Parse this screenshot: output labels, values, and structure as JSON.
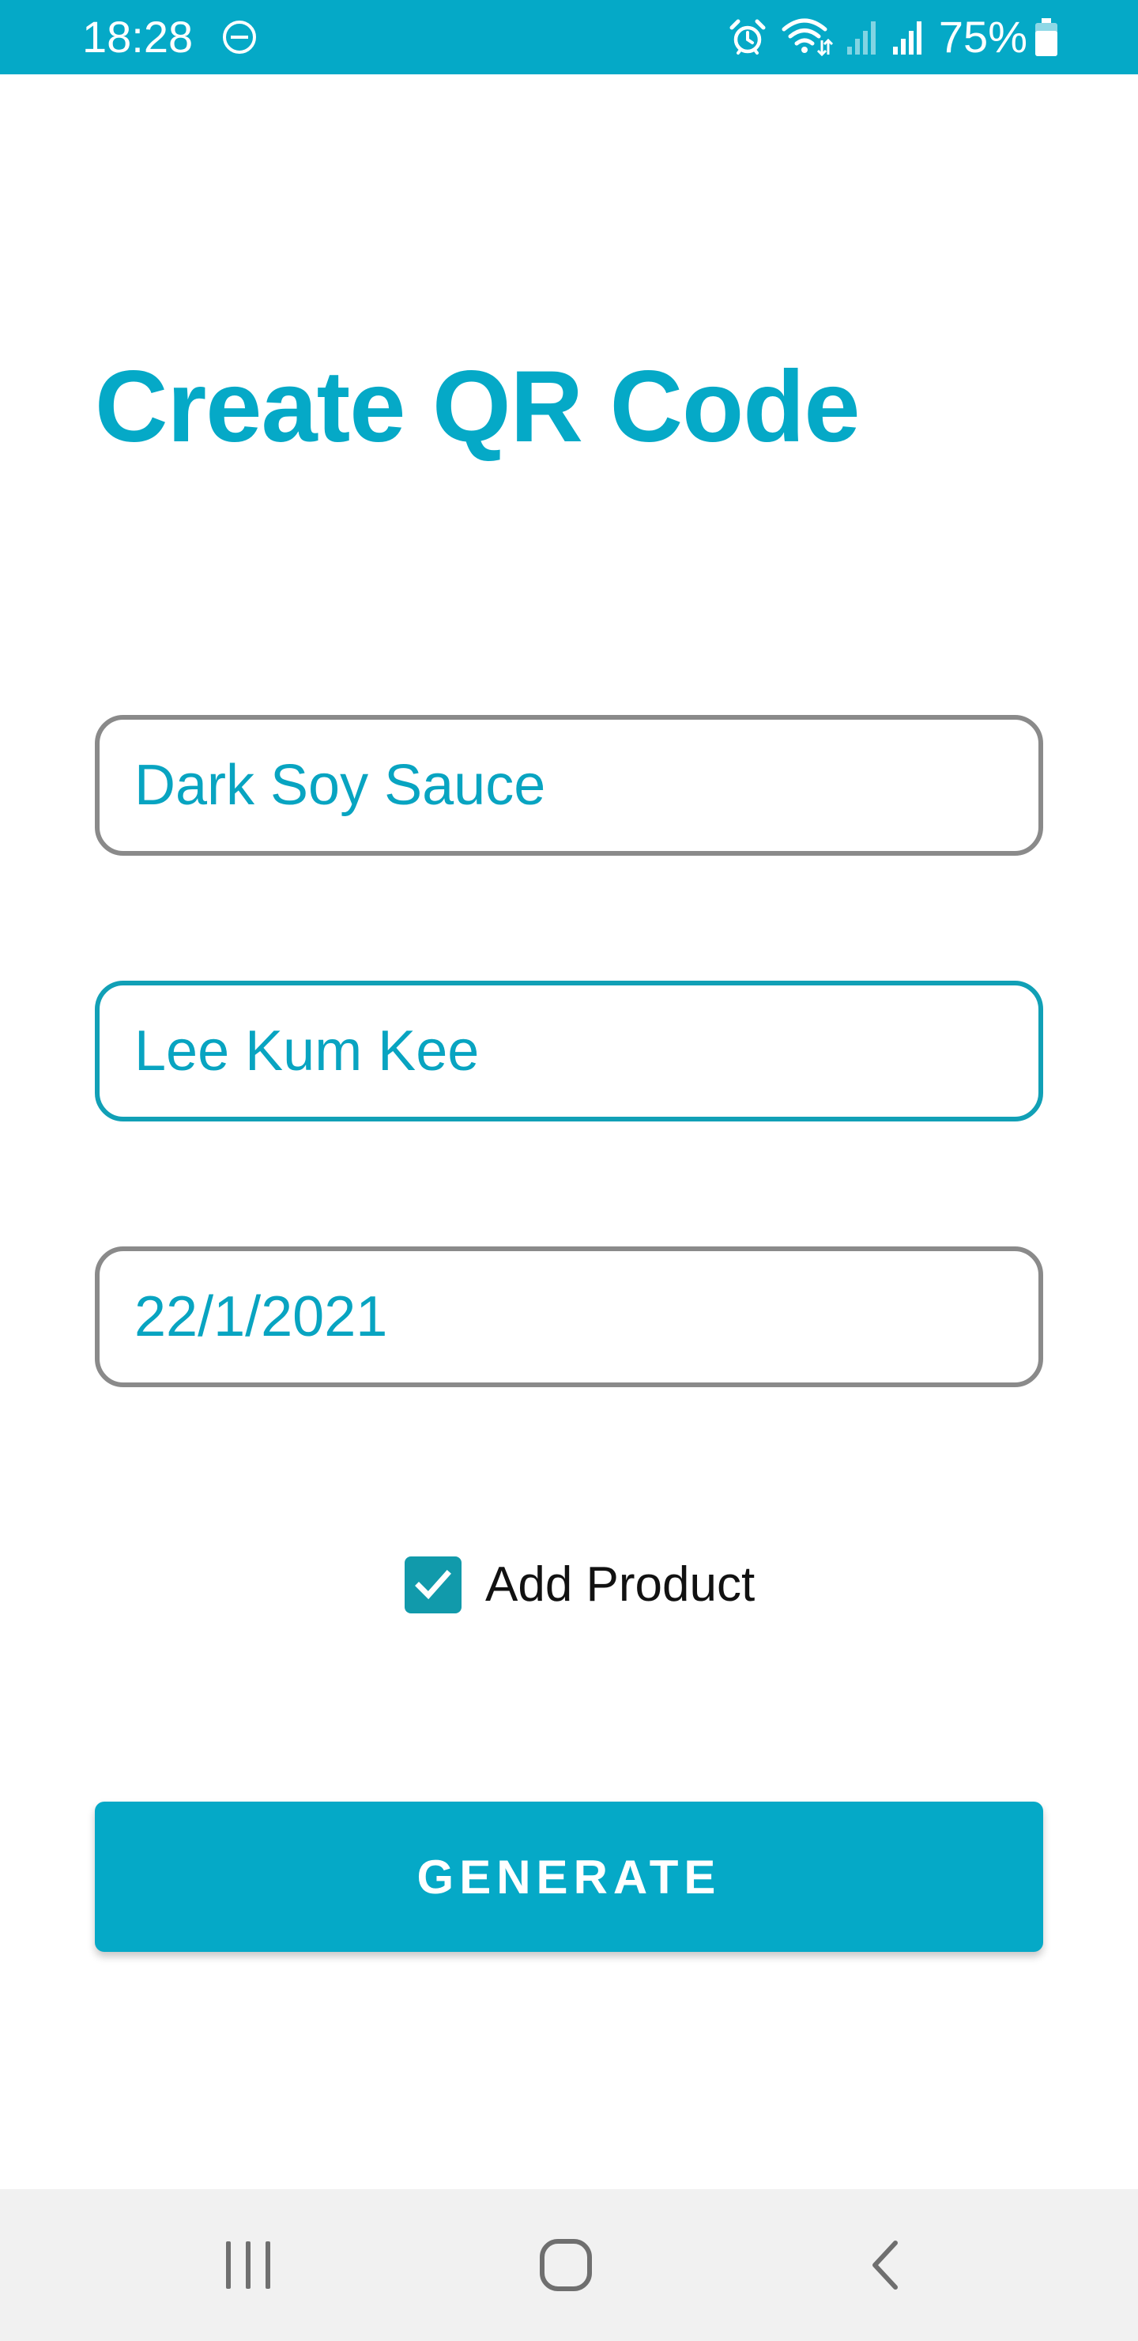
{
  "status_bar": {
    "time": "18:28",
    "battery": "75%",
    "background_color": "#05a9c7",
    "icons": [
      "do-not-disturb-icon",
      "alarm-icon",
      "wifi-icon",
      "signal-icon",
      "signal-icon",
      "battery-icon"
    ]
  },
  "main": {
    "title": "Create QR Code",
    "fields": {
      "product_name": "Dark Soy Sauce",
      "brand": "Lee Kum Kee",
      "date": "22/1/2021"
    },
    "checkbox": {
      "label": "Add Product",
      "checked": true
    },
    "generate_button": "GENERATE"
  },
  "nav_bar": {
    "icons": [
      "recents-icon",
      "home-icon",
      "back-icon"
    ]
  },
  "colors": {
    "accent": "#05a9c7",
    "field_border": "#8a8a8a",
    "focused_border": "#11a0b6",
    "checkbox": "#119aab"
  }
}
